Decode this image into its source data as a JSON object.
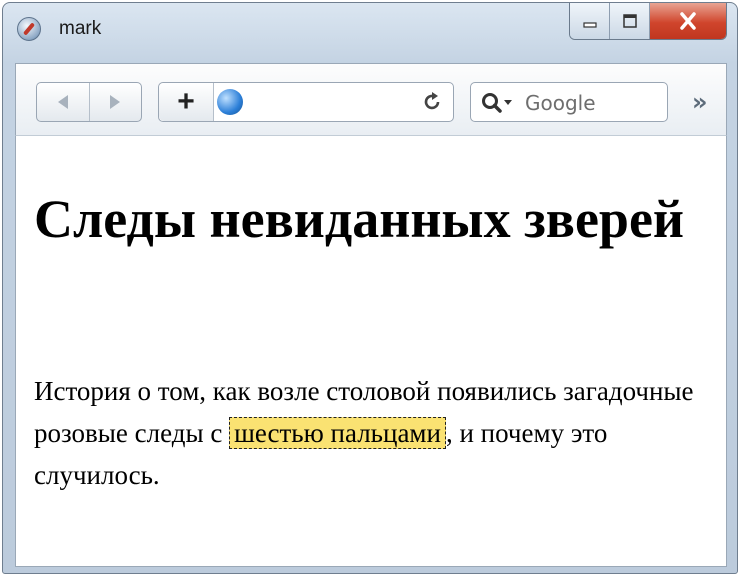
{
  "window": {
    "title": "mark"
  },
  "toolbar": {
    "back_icon": "back-arrow-icon",
    "forward_icon": "forward-arrow-icon",
    "add_label": "+",
    "address_value": "",
    "search_placeholder": "Google",
    "overflow_label": "»"
  },
  "page": {
    "heading": "Следы невиданных зверей",
    "text_before": "История о том, как возле столовой появились загадочные розовые следы с ",
    "highlight": "шестью пальцами",
    "text_after": ", и почему это случилось."
  },
  "colors": {
    "highlight_bg": "#fae272",
    "close_button": "#d0452c"
  }
}
